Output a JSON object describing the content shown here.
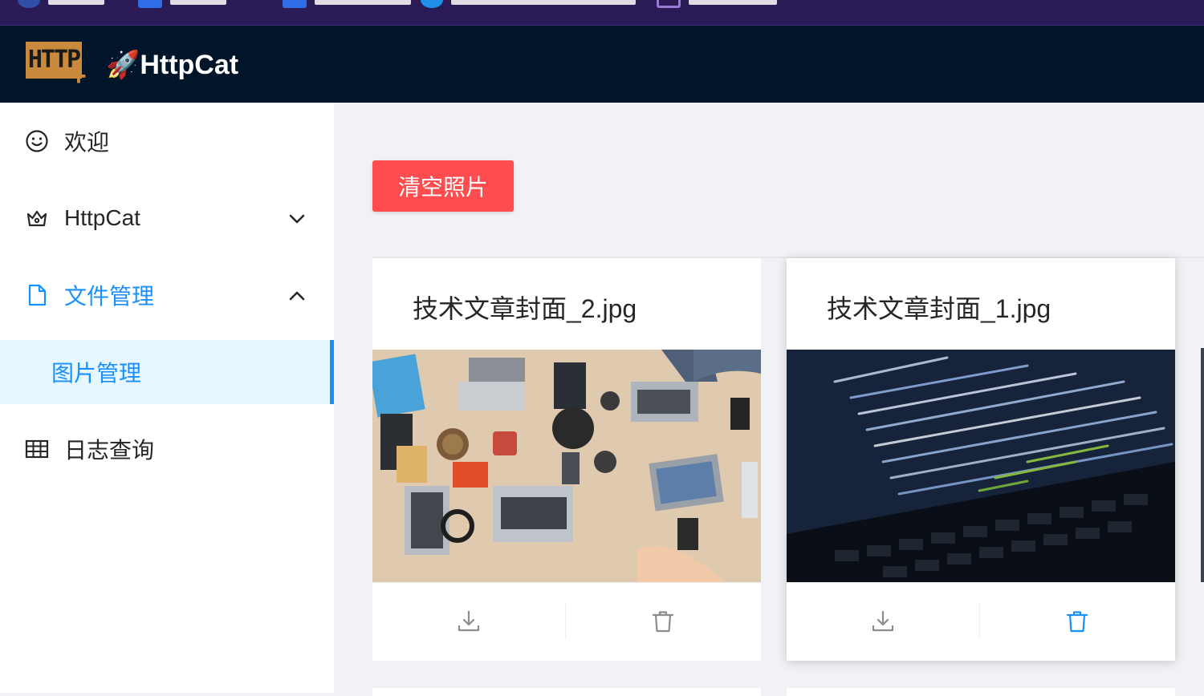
{
  "app": {
    "title": "🚀HttpCat",
    "logo_text": "HTTP",
    "logo_plus": "+"
  },
  "sidebar": {
    "items": [
      {
        "label": "欢迎",
        "icon": "smile-icon"
      },
      {
        "label": "HttpCat",
        "icon": "crown-icon"
      },
      {
        "label": "文件管理",
        "icon": "file-icon"
      },
      {
        "label": "日志查询",
        "icon": "table-icon"
      }
    ],
    "submenu": {
      "label": "图片管理"
    }
  },
  "toolbar": {
    "clear_label": "清空照片"
  },
  "cards": [
    {
      "title": "技术文章封面_2.jpg"
    },
    {
      "title": "技术文章封面_1.jpg"
    }
  ],
  "colors": {
    "header_bg": "#001529",
    "accent": "#1890ff",
    "danger": "#ff4d4f",
    "logo": "#c98a3d"
  }
}
